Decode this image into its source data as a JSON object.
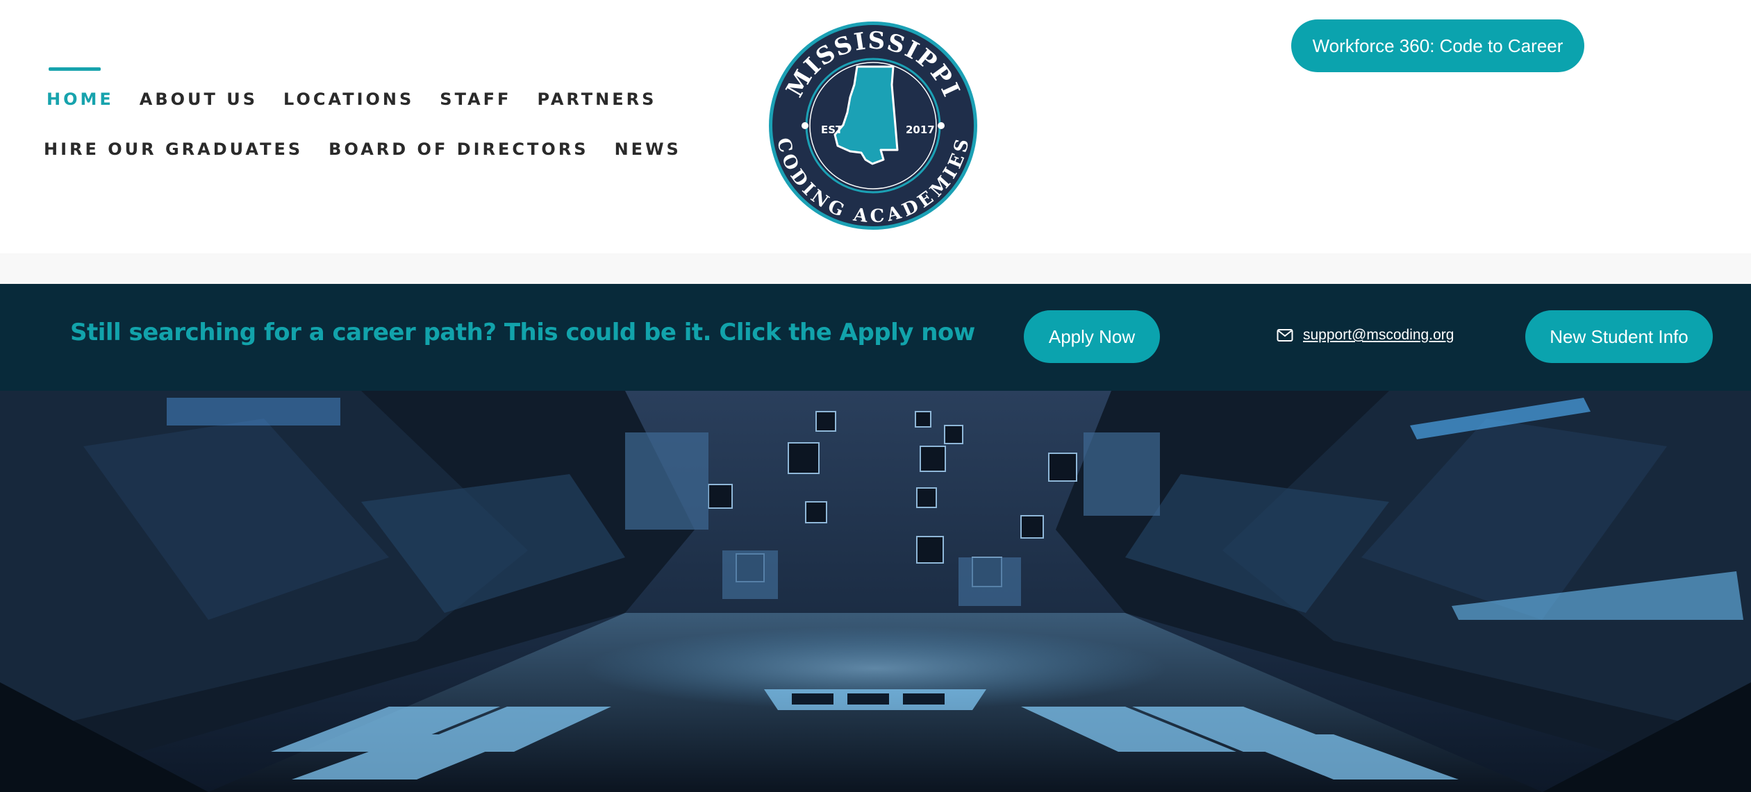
{
  "nav": {
    "row1": [
      "HOME",
      "ABOUT US",
      "LOCATIONS",
      "STAFF",
      "PARTNERS"
    ],
    "row2": [
      "HIRE OUR GRADUATES",
      "BOARD OF DIRECTORS",
      "NEWS"
    ],
    "active": "HOME"
  },
  "logo": {
    "top_text": "MISSISSIPPI",
    "bottom_text": "CODING ACADEMIES",
    "est_label": "EST",
    "year": "2017"
  },
  "header": {
    "workforce_button": "Workforce 360: Code to Career"
  },
  "banner": {
    "text": "Still searching for a career path? This could be it. Click the Apply now",
    "apply_button": "Apply Now",
    "support_email": "support@mscoding.org",
    "new_student_button": "New Student Info"
  },
  "hero": {
    "image": "futuristic-server-corridor"
  },
  "colors": {
    "accent": "#0ba3ae",
    "nav_text": "#2a2a2a",
    "banner_bg": "#082a3a",
    "logo_navy": "#1f2e4a"
  }
}
